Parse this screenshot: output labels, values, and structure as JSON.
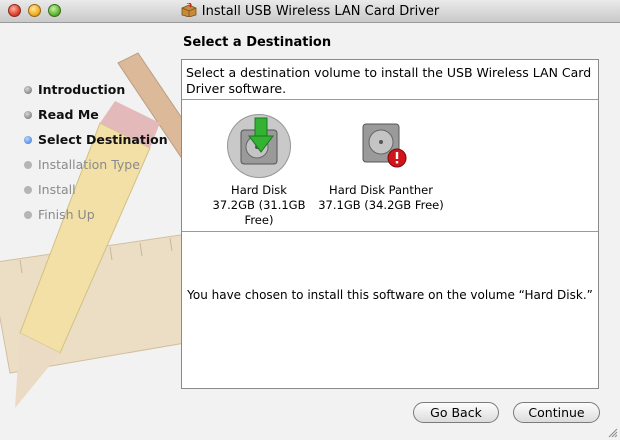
{
  "window": {
    "title": "Install USB Wireless LAN Card Driver"
  },
  "pane": {
    "title": "Select a Destination"
  },
  "steps": [
    {
      "label": "Introduction",
      "state": "done"
    },
    {
      "label": "Read Me",
      "state": "done"
    },
    {
      "label": "Select Destination",
      "state": "current"
    },
    {
      "label": "Installation Type",
      "state": "future"
    },
    {
      "label": "Install",
      "state": "future"
    },
    {
      "label": "Finish Up",
      "state": "future"
    }
  ],
  "content": {
    "instructions": "Select a destination volume to install the USB Wireless LAN Card Driver software.",
    "volumes": [
      {
        "name": "Hard Disk",
        "size": "37.2GB (31.1GB Free)",
        "selected": true,
        "icon": "hard-disk-install-icon"
      },
      {
        "name": "Hard Disk Panther",
        "size": "37.1GB (34.2GB Free)",
        "selected": false,
        "icon": "hard-disk-warning-icon"
      }
    ],
    "message": "You have chosen to install this software on the volume “Hard Disk.”"
  },
  "buttons": {
    "back": "Go Back",
    "continue": "Continue"
  },
  "colors": {
    "current_step_dot": "#2b6ed6",
    "warning_badge": "#d0141a",
    "install_arrow": "#33b233"
  }
}
